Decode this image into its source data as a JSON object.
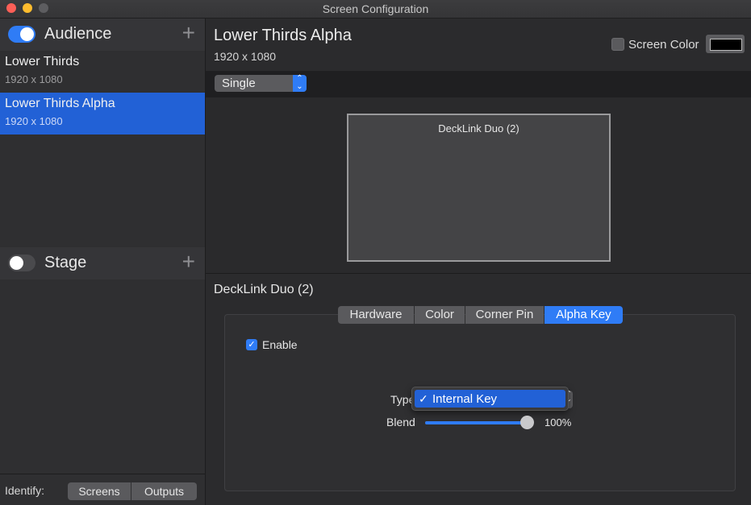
{
  "window": {
    "title": "Screen Configuration"
  },
  "sidebar": {
    "audience": {
      "title": "Audience",
      "enabled": true
    },
    "stage": {
      "title": "Stage",
      "enabled": false
    },
    "screens": [
      {
        "name": "Lower Thirds",
        "resolution": "1920 x 1080",
        "selected": false
      },
      {
        "name": "Lower Thirds Alpha",
        "resolution": "1920 x 1080",
        "selected": true
      }
    ],
    "identify": {
      "label": "Identify:",
      "screens": "Screens",
      "outputs": "Outputs"
    }
  },
  "main": {
    "title": "Lower Thirds Alpha",
    "resolution": "1920 x 1080",
    "screen_color": {
      "label": "Screen Color",
      "checked": false,
      "color": "#000000"
    },
    "mode": "Single",
    "preview_label": "DeckLink Duo (2)",
    "device_title": "DeckLink Duo (2)",
    "tabs": [
      {
        "label": "Hardware",
        "active": false
      },
      {
        "label": "Color",
        "active": false
      },
      {
        "label": "Corner Pin",
        "active": false
      },
      {
        "label": "Alpha Key",
        "active": true
      }
    ],
    "enable": {
      "label": "Enable",
      "checked": true
    },
    "type": {
      "label": "Type",
      "selected": "Internal Key"
    },
    "blend": {
      "label": "Blend",
      "value": "100%",
      "level": 1.0
    }
  },
  "colors": {
    "accent": "#2f7cf6",
    "selection": "#2261d6"
  }
}
